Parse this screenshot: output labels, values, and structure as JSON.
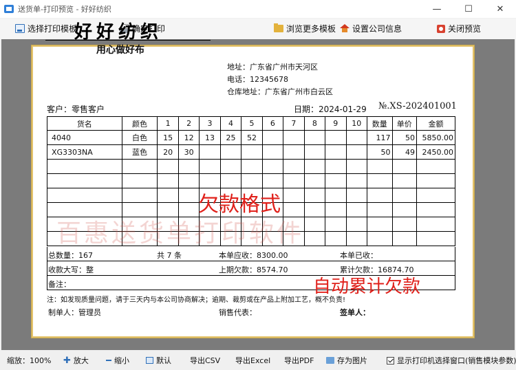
{
  "window": {
    "title": "送货单-打印预览 - 好好纺织",
    "minimize": "—",
    "maximize": "☐",
    "close": "✕"
  },
  "toolbar": {
    "select_template": "选择打印模板",
    "confirm_print": "确定打印",
    "browse_templates": "浏览更多模板",
    "company_settings": "设置公司信息",
    "close_preview": "关闭预览"
  },
  "document": {
    "company_name": "好好纺织",
    "slogan": "用心做好布",
    "address": "地址：广东省广州市天河区",
    "phone": "电话：12345678",
    "warehouse": "仓库地址：广东省广州市白云区",
    "customer": "客户：零售客户",
    "date": "日期：2024-01-29",
    "number": "№.XS-202401001",
    "headers": [
      "货名",
      "颜色",
      "1",
      "2",
      "3",
      "4",
      "5",
      "6",
      "7",
      "8",
      "9",
      "10",
      "数量",
      "单价",
      "金额"
    ],
    "rows": [
      [
        "4040",
        "白色",
        "15",
        "12",
        "13",
        "25",
        "52",
        "",
        "",
        "",
        "",
        "",
        "117",
        "50",
        "5850.00"
      ],
      [
        "XG3303NA",
        "蓝色",
        "20",
        "30",
        "",
        "",
        "",
        "",
        "",
        "",
        "",
        "",
        "50",
        "49",
        "2450.00"
      ],
      [
        "",
        "",
        "",
        "",
        "",
        "",
        "",
        "",
        "",
        "",
        "",
        "",
        "",
        "",
        ""
      ],
      [
        "",
        "",
        "",
        "",
        "",
        "",
        "",
        "",
        "",
        "",
        "",
        "",
        "",
        "",
        ""
      ],
      [
        "",
        "",
        "",
        "",
        "",
        "",
        "",
        "",
        "",
        "",
        "",
        "",
        "",
        "",
        ""
      ],
      [
        "",
        "",
        "",
        "",
        "",
        "",
        "",
        "",
        "",
        "",
        "",
        "",
        "",
        "",
        ""
      ],
      [
        "",
        "",
        "",
        "",
        "",
        "",
        "",
        "",
        "",
        "",
        "",
        "",
        "",
        "",
        ""
      ],
      [
        "",
        "",
        "",
        "",
        "",
        "",
        "",
        "",
        "",
        "",
        "",
        "",
        "",
        "",
        ""
      ]
    ],
    "total_qty": "总数量：167",
    "items_count": "共  7  条",
    "receivable": "本单应收：8300.00",
    "received": "本单已收：",
    "amount_words": "收款大写：整",
    "previous_debt": "上期欠款：8574.70",
    "cumulative_debt": "累计欠款：16874.70",
    "remark": "备注：",
    "notice": "注：如发现质量问题，请于三天内与本公司协商解决；逾期、裁剪或在产品上附加工艺，概不负责!",
    "maker": "制单人：管理员",
    "sales_rep": "销售代表：",
    "signer": "签单人："
  },
  "overlays": {
    "debt_format": "欠款格式",
    "auto_debt": "自动累计欠款",
    "watermark": "百惠送货单打印软件"
  },
  "statusbar": {
    "zoom": "缩放：100%",
    "zoom_in": "放大",
    "zoom_out": "缩小",
    "default": "默认",
    "export_csv": "导出CSV",
    "export_excel": "导出Excel",
    "export_pdf": "导出PDF",
    "save_image": "存为图片",
    "show_printer_dialog": "显示打印机选择窗口(销售模块参数)"
  },
  "colors": {
    "accent_red": "#e0211b",
    "paper_border": "#e3c26a",
    "preview_bg": "#7b7b7b"
  }
}
